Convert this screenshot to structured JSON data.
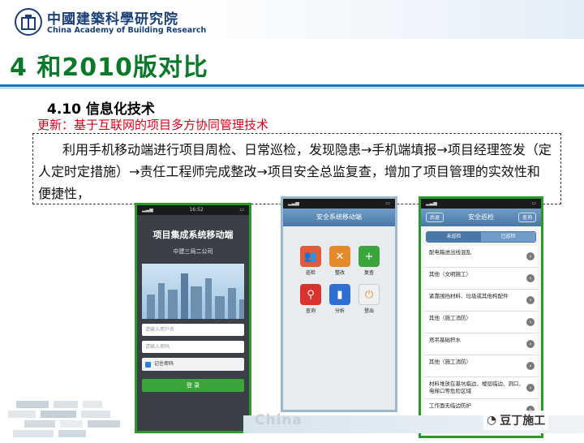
{
  "header": {
    "org_cn": "中國建築科學研究院",
    "org_en": "China Academy of Building Research"
  },
  "title": "4 和2010版对比",
  "section": {
    "title": "4.10 信息化技术",
    "update": "更新：基于互联网的项目多方协同管理技术",
    "description": "利用手机移动端进行项目周检、日常巡检，发现隐患→手机端填报→项目经理签发（定人定时定措施）→责任工程师完成整改→项目安全总监复查，增加了项目管理的实效性和便捷性，"
  },
  "phone1": {
    "app_title": "项目集成系统移动端",
    "company": "中建三局二公司",
    "username_placeholder": "请输入用户名",
    "password_placeholder": "请输入密码",
    "remember": "记住密码",
    "login": "登 录",
    "time": "16:52"
  },
  "phone2": {
    "header": "安全系统移动端",
    "items": [
      {
        "label": "巡检",
        "icon": "people-icon",
        "color": "#e55a3a"
      },
      {
        "label": "整改",
        "icon": "tools-icon",
        "color": "#e58a2a"
      },
      {
        "label": "复查",
        "icon": "add-person-icon",
        "color": "#3aa53a"
      },
      {
        "label": "查询",
        "icon": "magnifier-icon",
        "color": "#d8332e"
      },
      {
        "label": "分析",
        "icon": "bar-chart-icon",
        "color": "#2f6fd4"
      },
      {
        "label": "登出",
        "icon": "power-icon",
        "color": "#f0f0f0"
      }
    ]
  },
  "phone3": {
    "back": "后退",
    "header": "安全巡检",
    "query": "查询",
    "tab_todo": "未巡检",
    "tab_done": "已巡检",
    "items": [
      {
        "text": "配电箱进出线混乱"
      },
      {
        "text": "其他（文明施工）"
      },
      {
        "text": "紧靠围挡材料、垃圾或其他构配件"
      },
      {
        "text": "其他（施工消防）"
      },
      {
        "text": "塔吊基础积水"
      },
      {
        "text": "其他（施工消防）"
      },
      {
        "text": "材料堆放在基坑临边、楼层临边、洞口、电梯口等危险区域"
      },
      {
        "text": "工作面无临边防护"
      }
    ]
  },
  "footer": {
    "watermark": "China",
    "brand": "豆丁施工"
  }
}
